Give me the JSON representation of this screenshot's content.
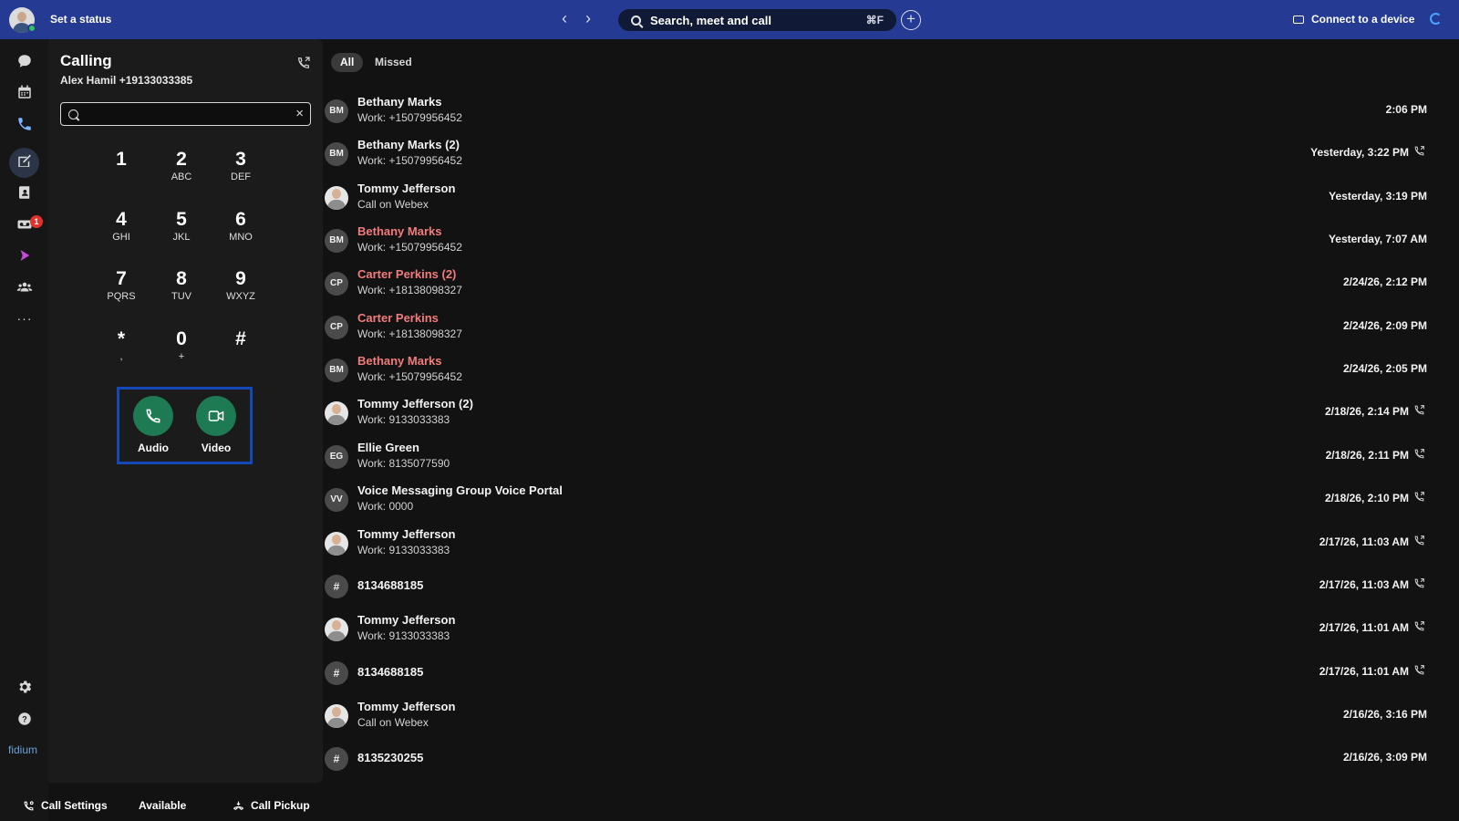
{
  "topbar": {
    "status_label": "Set a status",
    "search_label": "Search, meet and call",
    "search_shortcut": "⌘F",
    "connect_label": "Connect to a device"
  },
  "rail": {
    "icons": [
      "messaging-icon",
      "calendar-icon",
      "calling-icon",
      "whiteboard-icon",
      "contacts-icon",
      "voicemail-icon",
      "app-icon",
      "teams-icon",
      "more-icon",
      "settings-icon",
      "help-icon"
    ],
    "voicemail_badge": "1",
    "brand_text": "fidium"
  },
  "dialer": {
    "title": "Calling",
    "user_line": "Alex Hamil +19133033385",
    "search_value": "",
    "keys": [
      {
        "digit": "1",
        "letters": ""
      },
      {
        "digit": "2",
        "letters": "ABC"
      },
      {
        "digit": "3",
        "letters": "DEF"
      },
      {
        "digit": "4",
        "letters": "GHI"
      },
      {
        "digit": "5",
        "letters": "JKL"
      },
      {
        "digit": "6",
        "letters": "MNO"
      },
      {
        "digit": "7",
        "letters": "PQRS"
      },
      {
        "digit": "8",
        "letters": "TUV"
      },
      {
        "digit": "9",
        "letters": "WXYZ"
      },
      {
        "digit": "*",
        "letters": ","
      },
      {
        "digit": "0",
        "letters": "+"
      },
      {
        "digit": "#",
        "letters": ""
      }
    ],
    "audio_label": "Audio",
    "video_label": "Video"
  },
  "bottom": {
    "call_settings": "Call Settings",
    "availability": "Available",
    "call_pickup": "Call Pickup"
  },
  "calls": {
    "filters": [
      "All",
      "Missed"
    ],
    "active_filter": "All",
    "missed_color": "#f27c7c",
    "items": [
      {
        "initials": "BM",
        "avatar": "initials",
        "name": "Bethany Marks",
        "detail": "Work: +15079956452",
        "time": "2:06 PM",
        "missed": false,
        "outgoing": false
      },
      {
        "initials": "BM",
        "avatar": "initials",
        "name": "Bethany Marks (2)",
        "detail": "Work: +15079956452",
        "time": "Yesterday, 3:22 PM",
        "missed": false,
        "outgoing": true
      },
      {
        "initials": "",
        "avatar": "photo",
        "name": "Tommy Jefferson",
        "detail": "Call on Webex",
        "time": "Yesterday, 3:19 PM",
        "missed": false,
        "outgoing": false
      },
      {
        "initials": "BM",
        "avatar": "initials",
        "name": "Bethany Marks",
        "detail": "Work: +15079956452",
        "time": "Yesterday, 7:07 AM",
        "missed": true,
        "outgoing": false
      },
      {
        "initials": "CP",
        "avatar": "initials",
        "name": "Carter Perkins (2)",
        "detail": "Work: +18138098327",
        "time": "2/24/26, 2:12 PM",
        "missed": true,
        "outgoing": false
      },
      {
        "initials": "CP",
        "avatar": "initials",
        "name": "Carter Perkins",
        "detail": "Work: +18138098327",
        "time": "2/24/26, 2:09 PM",
        "missed": true,
        "outgoing": false
      },
      {
        "initials": "BM",
        "avatar": "initials",
        "name": "Bethany Marks",
        "detail": "Work: +15079956452",
        "time": "2/24/26, 2:05 PM",
        "missed": true,
        "outgoing": false
      },
      {
        "initials": "",
        "avatar": "photo",
        "name": "Tommy Jefferson (2)",
        "detail": "Work: 9133033383",
        "time": "2/18/26, 2:14 PM",
        "missed": false,
        "outgoing": true
      },
      {
        "initials": "EG",
        "avatar": "initials",
        "name": "Ellie Green",
        "detail": "Work: 8135077590",
        "time": "2/18/26, 2:11 PM",
        "missed": false,
        "outgoing": true
      },
      {
        "initials": "VV",
        "avatar": "initials",
        "name": "Voice Messaging Group Voice Portal",
        "detail": "Work: 0000",
        "time": "2/18/26, 2:10 PM",
        "missed": false,
        "outgoing": true
      },
      {
        "initials": "",
        "avatar": "photo",
        "name": "Tommy Jefferson",
        "detail": "Work: 9133033383",
        "time": "2/17/26, 11:03 AM",
        "missed": false,
        "outgoing": true
      },
      {
        "initials": "#",
        "avatar": "hash",
        "name": "8134688185",
        "detail": "",
        "time": "2/17/26, 11:03 AM",
        "missed": false,
        "outgoing": true
      },
      {
        "initials": "",
        "avatar": "photo",
        "name": "Tommy Jefferson",
        "detail": "Work: 9133033383",
        "time": "2/17/26, 11:01 AM",
        "missed": false,
        "outgoing": true
      },
      {
        "initials": "#",
        "avatar": "hash",
        "name": "8134688185",
        "detail": "",
        "time": "2/17/26, 11:01 AM",
        "missed": false,
        "outgoing": true
      },
      {
        "initials": "",
        "avatar": "photo",
        "name": "Tommy Jefferson",
        "detail": "Call on Webex",
        "time": "2/16/26, 3:16 PM",
        "missed": false,
        "outgoing": false
      },
      {
        "initials": "#",
        "avatar": "hash",
        "name": "8135230255",
        "detail": "",
        "time": "2/16/26, 3:09 PM",
        "missed": false,
        "outgoing": false
      }
    ]
  }
}
